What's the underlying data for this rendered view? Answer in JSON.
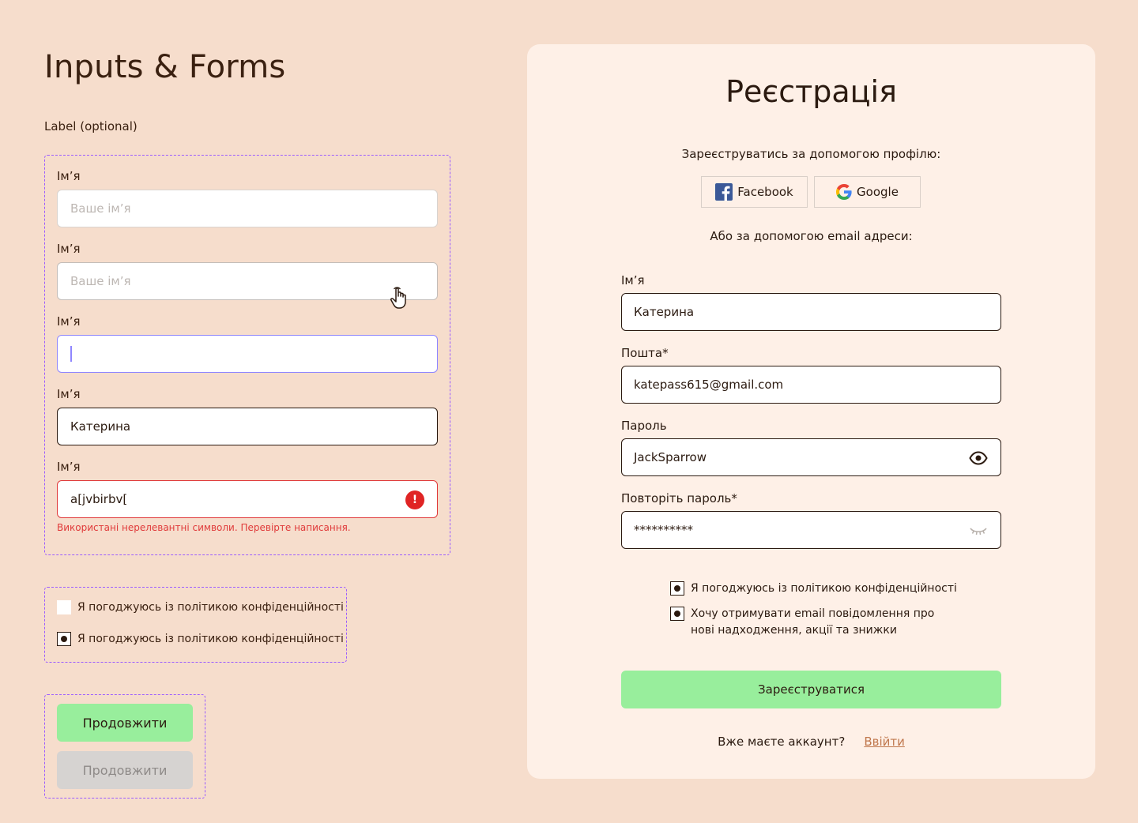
{
  "page": {
    "title": "Inputs & Forms",
    "label_optional": "Label (optional)"
  },
  "inputs": [
    {
      "label": "Ім’я",
      "placeholder": "Ваше ім’я",
      "state": "default"
    },
    {
      "label": "Ім’я",
      "placeholder": "Ваше ім’я",
      "state": "hover"
    },
    {
      "label": "Ім’я",
      "value": "",
      "state": "focus"
    },
    {
      "label": "Ім’я",
      "value": "Катерина",
      "state": "filled"
    },
    {
      "label": "Ім’я",
      "value": "a[jvbirbv[",
      "state": "error",
      "error_icon": "!",
      "error_message": "Використані нерелевантні символи. Перевірте написання."
    }
  ],
  "checkboxes": [
    {
      "label": "Я погоджуюсь із політикою конфіденційності",
      "checked": false
    },
    {
      "label": "Я погоджуюсь із політикою конфіденційності",
      "checked": true
    }
  ],
  "buttons": {
    "primary": "Продовжити",
    "disabled": "Продовжити"
  },
  "registration": {
    "title": "Реєстрація",
    "social_prompt": "Зареєструватись за допомогою профілю:",
    "social": [
      {
        "label": "Facebook",
        "icon": "facebook-icon"
      },
      {
        "label": "Google",
        "icon": "google-icon"
      }
    ],
    "email_prompt": "Або за допомогою email адреси:",
    "fields": {
      "name": {
        "label": "Ім’я",
        "value": "Катерина"
      },
      "email": {
        "label": "Пошта*",
        "value": "katepass615@gmail.com"
      },
      "password": {
        "label": "Пароль",
        "value": "JackSparrow",
        "icon": "eye-icon"
      },
      "password_repeat": {
        "label": "Повторіть пароль*",
        "value": "**********",
        "icon": "eye-closed-icon"
      }
    },
    "agreements": [
      {
        "label": "Я погоджуюсь із політикою конфіденційності",
        "checked": true
      },
      {
        "label_line1": "Хочу отримувати email повідомлення про",
        "label_line2": "нові надходження, акції та знижки",
        "checked": true
      }
    ],
    "submit": "Зареєструватися",
    "have_account": "Вже маєте аккаунт?",
    "login_link": "Ввійти"
  },
  "colors": {
    "background": "#f6ddcc",
    "card": "#fef0e7",
    "accent_green": "#98ee9c",
    "error": "#e03a3a",
    "focus": "#8f86ff",
    "dashed_outline": "#9b5cff",
    "link": "#c0784e"
  }
}
